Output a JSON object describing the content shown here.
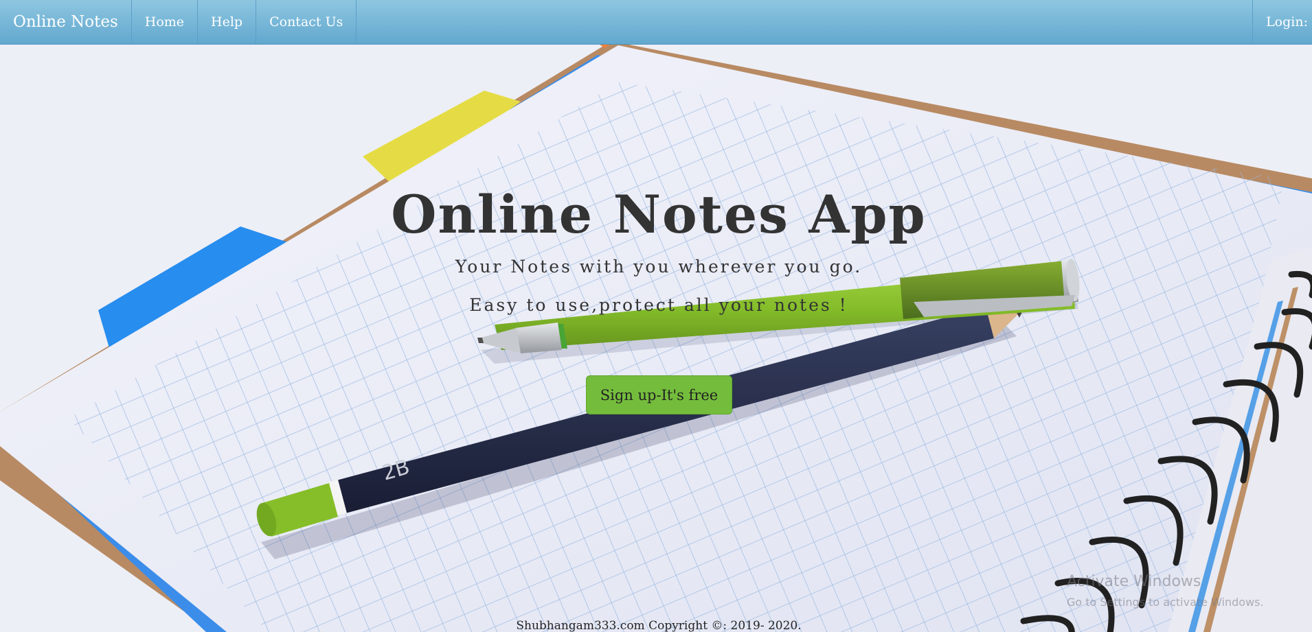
{
  "navbar": {
    "brand": "Online Notes",
    "links": [
      "Home",
      "Help",
      "Contact Us"
    ],
    "login": "Login:"
  },
  "hero": {
    "title": "Online Notes App",
    "subtitle": "Your Notes with you wherever you go.",
    "tagline": "Easy to use,protect all your notes !",
    "signup_label": "Sign up-It's free"
  },
  "footer": {
    "copyright": "Shubhangam333.com Copyright ©: 2019- 2020."
  },
  "watermark": {
    "title": "Activate Windows",
    "subtitle": "Go to Settings to activate Windows."
  },
  "colors": {
    "navbar": "#6fb3d6",
    "signup_button": "#74bd3c",
    "text": "#333333"
  },
  "icons": {
    "background": "notebook-with-pen-and-pencil-illustration"
  }
}
